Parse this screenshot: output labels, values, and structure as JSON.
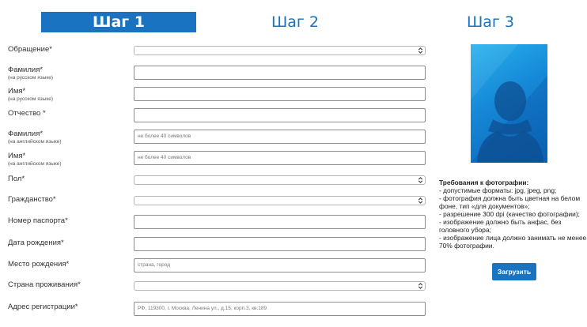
{
  "tabs": [
    {
      "label": "Шаг 1"
    },
    {
      "label": "Шаг 2"
    },
    {
      "label": "Шаг 3"
    }
  ],
  "form": {
    "salutation": {
      "label": "Обращение*",
      "value": ""
    },
    "last_name_ru": {
      "label": "Фамилия*",
      "sub": "(на русском языке)",
      "value": ""
    },
    "first_name_ru": {
      "label": "Имя*",
      "sub": "(на русском языке)",
      "value": ""
    },
    "patronymic": {
      "label": "Отчество *",
      "value": ""
    },
    "last_name_en": {
      "label": "Фамилия*",
      "sub": "(на английском языке)",
      "placeholder": "не более 40 символов"
    },
    "first_name_en": {
      "label": "Имя*",
      "sub": "(на английском языке)",
      "placeholder": "не более 40 символов"
    },
    "gender": {
      "label": "Пол*",
      "value": ""
    },
    "citizenship": {
      "label": "Гражданство*",
      "value": ""
    },
    "passport": {
      "label": "Номер паспорта*",
      "value": ""
    },
    "birth_date": {
      "label": "Дата рождения*",
      "value": ""
    },
    "birth_place": {
      "label": "Место рождения*",
      "placeholder": "страна, город"
    },
    "residence_country": {
      "label": "Страна проживания*",
      "value": ""
    },
    "registration_address": {
      "label": "Адрес регистрации*",
      "placeholder": "РФ, 119300, г. Москва, Ленина ул., д.15, корп.3, кв.189"
    }
  },
  "photo": {
    "requirements_title": "Требования к фотографии:",
    "requirements": [
      "- допустимые форматы: jpg, jpeg, png;",
      "- фотография должна быть цветная на белом",
      "фоне, тип «для документов»;",
      "- разрешение 300 dpi (качество фотографии);",
      "- изображение должно быть анфас, без",
      "головного убора;",
      "- изображение лица должно занимать не менее",
      "70% фотографии."
    ],
    "upload_label": "Загрузить"
  },
  "colors": {
    "accent": "#1a73c0",
    "photo_light": "#27b2ee",
    "photo_dark": "#0b63b8"
  },
  "icons": {
    "select_arrow": "chevron-updown-icon",
    "photo_placeholder": "person-silhouette-icon"
  }
}
